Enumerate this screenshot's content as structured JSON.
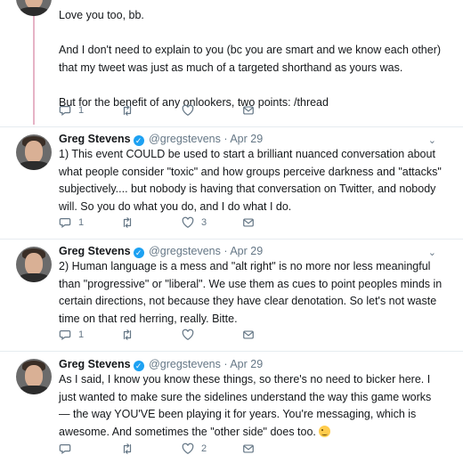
{
  "top_tweet": {
    "text": "Love you too, bb.\n\nAnd I don't need to explain to you (bc you are smart and we know each other) that my tweet was just as much of a targeted shorthand as yours was.\n\n But for the benefit of any onlookers, two points: /thread",
    "reply_count": "1",
    "like_count": ""
  },
  "tweets": [
    {
      "name": "Greg Stevens",
      "handle": "@gregstevens",
      "separator": "·",
      "date": "Apr 29",
      "text": "1) This event COULD be used to start a brilliant nuanced conversation about what people consider \"toxic\" and how groups perceive darkness and \"attacks\" subjectively.... but nobody is having that conversation on Twitter, and nobody will. So you do what you do, and I do what I do.",
      "reply_count": "1",
      "retweet_count": "",
      "like_count": "3"
    },
    {
      "name": "Greg Stevens",
      "handle": "@gregstevens",
      "separator": "·",
      "date": "Apr 29",
      "text": "2) Human language is a mess and \"alt right\" is no more nor less meaningful than \"progressive\" or \"liberal\". We use them as cues to point peoples minds in certain directions, not because they have clear denotation. So let's not waste time on that red herring, really. Bitte.",
      "reply_count": "1",
      "retweet_count": "",
      "like_count": ""
    },
    {
      "name": "Greg Stevens",
      "handle": "@gregstevens",
      "separator": "·",
      "date": "Apr 29",
      "text": "As I said, I know you know these things, so there's no need to bicker here. I just wanted to make sure the sidelines understand the way this game works — the way YOU'VE been playing it for years. You're messaging, which is awesome. And sometimes the \"other side\" does too.",
      "emoji": "winking-face",
      "reply_count": "",
      "retweet_count": "",
      "like_count": "2"
    }
  ],
  "icons": {
    "reply": "reply-icon",
    "retweet": "retweet-icon",
    "like": "heart-icon",
    "dm": "envelope-icon",
    "verified": "verified-badge-icon",
    "menu": "chevron-down-icon"
  },
  "colors": {
    "accent": "#1da1f2",
    "thread_line": "#e6b3c6",
    "muted_text": "#657786",
    "divider": "#e6ecf0"
  }
}
